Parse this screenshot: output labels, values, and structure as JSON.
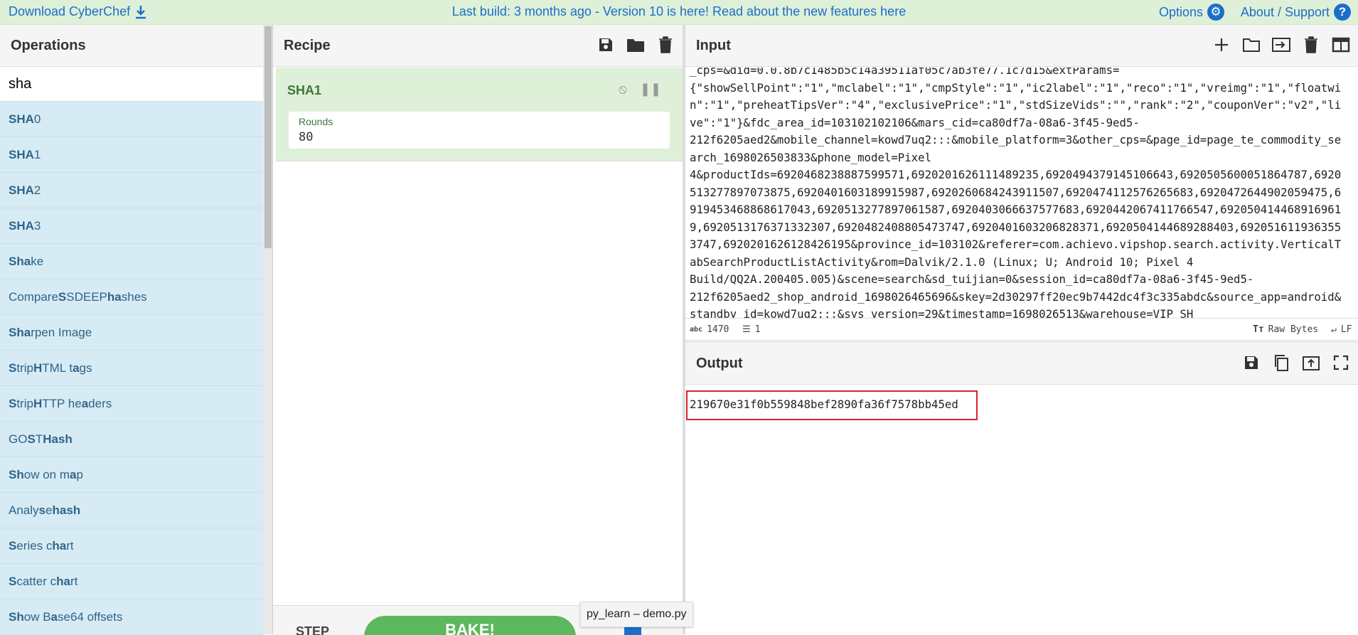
{
  "banner": {
    "download_label": "Download CyberChef",
    "notice_text": "Last build: 3 months ago - Version 10 is here! Read about the new features ",
    "notice_link": "here",
    "options_label": "Options",
    "about_label": "About / Support",
    "accent_color": "#1a6fc9",
    "background_color": "#dff0d8"
  },
  "operations": {
    "title": "Operations",
    "search_value": "sha",
    "items": [
      [
        "SHA",
        "0"
      ],
      [
        "SHA",
        "1"
      ],
      [
        "SHA",
        "2"
      ],
      [
        "SHA",
        "3"
      ],
      [
        "Sha",
        "ke"
      ],
      [
        "Compare ",
        "S",
        "SDEEP ",
        "ha",
        "shes"
      ],
      [
        "Sha",
        "rpen Image"
      ],
      [
        "S",
        "trip ",
        "H",
        "TML t",
        "a",
        "gs"
      ],
      [
        "S",
        "trip ",
        "H",
        "TTP he",
        "a",
        "ders"
      ],
      [
        "GO",
        "S",
        "T ",
        "Ha",
        "sh"
      ],
      [
        "Sh",
        "ow on m",
        "a",
        "p"
      ],
      [
        "Analy",
        "s",
        "e ",
        "ha",
        "sh"
      ],
      [
        "S",
        "eries c",
        "ha",
        "rt"
      ],
      [
        "S",
        "catter c",
        "ha",
        "rt"
      ],
      [
        "Sh",
        "ow B",
        "a",
        "se64 offsets"
      ]
    ]
  },
  "recipe": {
    "title": "Recipe",
    "operation": {
      "name": "SHA1",
      "arg_label": "Rounds",
      "arg_value": "80"
    },
    "step_label": "STEP",
    "bake_label": "BAKE!"
  },
  "input": {
    "title": "Input",
    "lines": [
      "_cps=&did=0.0.8b7c1485b5c14a39511af05c7ab3fe77.1c7d15&extParams=",
      "{\"showSellPoint\":\"1\",\"mclabel\":\"1\",\"cmpStyle\":\"1\",\"ic2label\":\"1\",\"reco\":\"1\",\"vreimg\":\"1\",\"floatwi",
      "n\":\"1\",\"preheatTipsVer\":\"4\",\"exclusivePrice\":\"1\",\"stdSizeVids\":\"\",\"rank\":\"2\",\"couponVer\":\"v2\",\"li",
      "ve\":\"1\"}&fdc_area_id=103102102106&mars_cid=ca80df7a-08a6-3f45-9ed5-",
      "212f6205aed2&mobile_channel=kowd7uq2:::&mobile_platform=3&other_cps=&page_id=page_te_commodity_se",
      "arch_1698026503833&phone_model=Pixel",
      "4&productIds=6920468238887599571,6920201626111489235,6920494379145106643,6920505600051864787,6920",
      "513277897073875,6920401603189915987,6920260684243911507,6920474112576265683,6920472644902059475,6",
      "919453468868617043,6920513277897061587,6920403066637577683,6920442067411766547,692050414468916961",
      "9,6920513176371332307,6920482408805473747,6920401603206828371,6920504144689288403,692051611936355",
      "3747,6920201626128426195&province_id=103102&referer=com.achievo.vipshop.search.activity.VerticalT",
      "abSearchProductListActivity&rom=Dalvik/2.1.0 (Linux; U; Android 10; Pixel 4",
      "Build/QQ2A.200405.005)&scene=search&sd_tuijian=0&session_id=ca80df7a-08a6-3f45-9ed5-",
      "212f6205aed2_shop_android_1698026465696&skey=2d30297ff20ec9b7442dc4f3c335abdc&source_app=android&",
      "standby_id=kowd7uq2:::&sys_version=29&timestamp=1698026513&warehouse=VIP_SH"
    ],
    "char_count_icon": "abc",
    "char_count": "1470",
    "line_count": "1",
    "encoding_label": "Raw Bytes",
    "eol_label": "LF"
  },
  "output": {
    "title": "Output",
    "value": "219670e31f0b559848bef2890fa36f7578bb45ed",
    "highlight_color": "#d9222a"
  },
  "tooltip": {
    "text": "py_learn – demo.py"
  }
}
